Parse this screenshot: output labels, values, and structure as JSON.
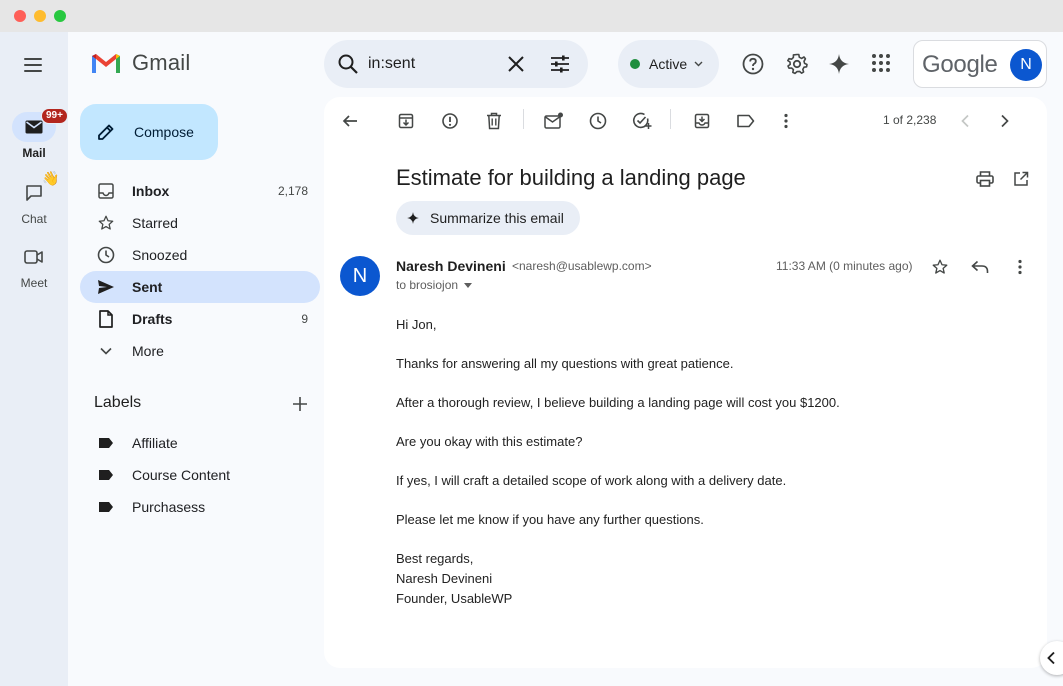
{
  "rail": {
    "mail_label": "Mail",
    "mail_badge": "99+",
    "chat_label": "Chat",
    "chat_emoji": "👋",
    "meet_label": "Meet"
  },
  "app": {
    "name": "Gmail"
  },
  "compose": {
    "label": "Compose"
  },
  "nav": [
    {
      "label": "Inbox",
      "count": "2,178",
      "icon": "inbox-icon"
    },
    {
      "label": "Starred",
      "count": "",
      "icon": "star-icon"
    },
    {
      "label": "Snoozed",
      "count": "",
      "icon": "clock-icon"
    },
    {
      "label": "Sent",
      "count": "",
      "icon": "send-icon"
    },
    {
      "label": "Drafts",
      "count": "9",
      "icon": "draft-icon"
    },
    {
      "label": "More",
      "count": "",
      "icon": "chevron-down-icon"
    }
  ],
  "labels": {
    "heading": "Labels",
    "items": [
      "Affiliate",
      "Course Content",
      "Purchasess"
    ]
  },
  "search": {
    "value": "in:sent"
  },
  "status": {
    "label": "Active"
  },
  "account": {
    "brand": "Google",
    "initial": "N"
  },
  "toolbar": {
    "pager": "1 of 2,238"
  },
  "email": {
    "subject": "Estimate for building a landing page",
    "summarize_label": "Summarize this email",
    "sender_initial": "N",
    "sender_name": "Naresh Devineni",
    "sender_email": "<naresh@usablewp.com>",
    "to": "to brosiojon",
    "time": "11:33 AM (0 minutes ago)",
    "greeting": "Hi Jon,",
    "p1": "Thanks for answering all my questions with great patience.",
    "p2": "After a thorough review, I believe building a landing page will cost you $1200.",
    "p3": "Are you okay with this estimate?",
    "p4": "If yes, I will craft a detailed scope of work along with a delivery date.",
    "p5": "Please let me know if you have any further questions.",
    "sign1": "Best regards,",
    "sign2": "Naresh Devineni",
    "sign3": "Founder, UsableWP"
  },
  "colors": {
    "accent": "#0b57d0",
    "compose_bg": "#c2e7ff",
    "active_nav": "#d3e3fd",
    "status_green": "#1e8e3e",
    "badge_red": "#b3261e"
  }
}
